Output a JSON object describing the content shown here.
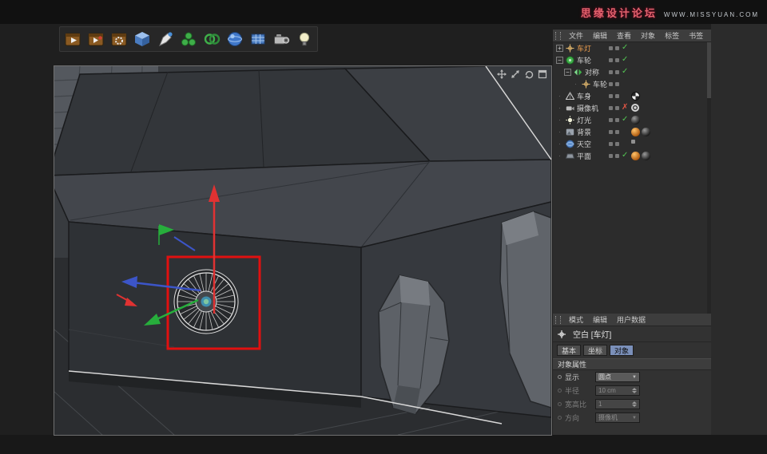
{
  "branding": {
    "site_name": "思缘设计论坛",
    "site_url": "WWW.MISSYUAN.COM"
  },
  "toolbar": {
    "tools": [
      {
        "name": "render-view",
        "type": "render-a"
      },
      {
        "name": "render-picture-viewer",
        "type": "render-b"
      },
      {
        "name": "render-settings",
        "type": "render-c"
      },
      {
        "name": "primitive-cube",
        "type": "cube"
      },
      {
        "name": "spline-pen",
        "type": "pen"
      },
      {
        "name": "generator-array",
        "type": "array"
      },
      {
        "name": "modeling-boole",
        "type": "boole"
      },
      {
        "name": "primitive-sphere",
        "type": "sphere"
      },
      {
        "name": "primitive-plane",
        "type": "grid"
      },
      {
        "name": "camera-tool",
        "type": "camera"
      },
      {
        "name": "light-tool",
        "type": "bulb"
      }
    ]
  },
  "viewport": {
    "nav": [
      {
        "name": "pan",
        "type": "pan"
      },
      {
        "name": "zoom",
        "type": "zoom"
      },
      {
        "name": "rotate",
        "type": "rotate"
      },
      {
        "name": "maximize",
        "type": "maximize"
      }
    ]
  },
  "object_manager": {
    "menu": [
      "文件",
      "编辑",
      "查看",
      "对象",
      "标签",
      "书签"
    ],
    "rows": [
      {
        "label": "车灯",
        "depth": 0,
        "expander": "plus",
        "icon": "null",
        "check": "green",
        "selected": true,
        "tags": []
      },
      {
        "label": "车轮",
        "depth": 0,
        "expander": "minus",
        "icon": "wheel",
        "check": "green",
        "selected": false,
        "tags": []
      },
      {
        "label": "对称",
        "depth": 1,
        "expander": "minus",
        "icon": "symmetry",
        "check": "green",
        "selected": false,
        "tags": []
      },
      {
        "label": "车轮",
        "depth": 2,
        "expander": "none",
        "icon": "null",
        "check": "none",
        "selected": false,
        "tags": []
      },
      {
        "label": "车身",
        "depth": 0,
        "expander": "none",
        "icon": "mesh",
        "check": "none",
        "selected": false,
        "tags": [
          "checker-sphere"
        ]
      },
      {
        "label": "摄像机",
        "depth": 0,
        "expander": "none",
        "icon": "camera",
        "check": "red",
        "selected": false,
        "tags": [
          "target"
        ]
      },
      {
        "label": "灯光",
        "depth": 0,
        "expander": "none",
        "icon": "light",
        "check": "green",
        "selected": false,
        "tags": [
          "dark-sphere"
        ]
      },
      {
        "label": "背景",
        "depth": 0,
        "expander": "none",
        "icon": "background",
        "check": "none",
        "selected": false,
        "tags": [
          "orange-sphere",
          "dark-sphere"
        ]
      },
      {
        "label": "天空",
        "depth": 0,
        "expander": "none",
        "icon": "sky",
        "check": "none",
        "selected": false,
        "tags": [
          "small-dot"
        ]
      },
      {
        "label": "平面",
        "depth": 0,
        "expander": "none",
        "icon": "plane",
        "check": "green",
        "selected": false,
        "tags": [
          "orange-sphere",
          "dark-sphere"
        ]
      }
    ]
  },
  "attribute_manager": {
    "menu": [
      "模式",
      "编辑",
      "用户数据"
    ],
    "object_title": "空白 [车灯]",
    "tabs": [
      {
        "label": "基本",
        "active": false
      },
      {
        "label": "坐标",
        "active": false
      },
      {
        "label": "对象",
        "active": true
      }
    ],
    "section": "对象属性",
    "properties": [
      {
        "label": "显示",
        "value": "圆点",
        "control": "dropdown",
        "enabled": true
      },
      {
        "label": "半径",
        "value": "10 cm",
        "control": "number",
        "enabled": false
      },
      {
        "label": "宽高比",
        "value": "1",
        "control": "number",
        "enabled": false
      },
      {
        "label": "方向",
        "value": "摄像机",
        "control": "dropdown",
        "enabled": false
      }
    ]
  },
  "colors": {
    "selection_red": "#e01010",
    "axis_red": "#e03232",
    "axis_green": "#27ae3c",
    "axis_blue": "#3c55c8",
    "check_green": "#53c553",
    "tab_active": "#7b90ba",
    "brand_pink": "#e2636e"
  }
}
